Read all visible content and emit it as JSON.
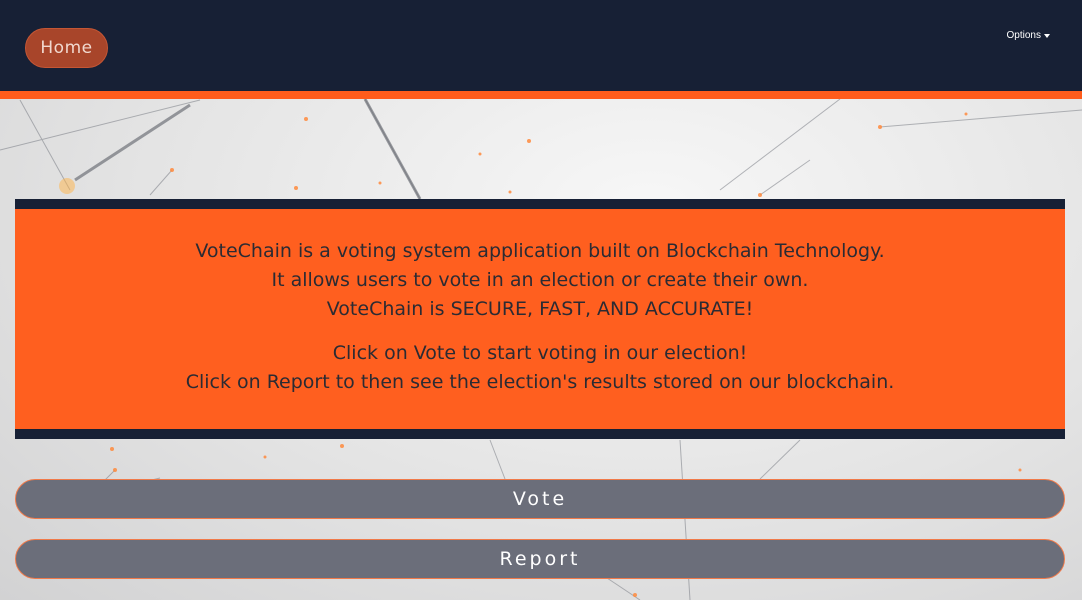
{
  "navbar": {
    "home_label": "Home",
    "options_label": "Options"
  },
  "info": {
    "lines_1": [
      "VoteChain is a voting system application built on Blockchain Technology.",
      "It allows users to vote in an election or create their own.",
      "VoteChain is SECURE, FAST, AND ACCURATE!"
    ],
    "lines_2": [
      "Click on Vote to start voting in our election!",
      "Click on Report to then see the election's results stored on our blockchain."
    ]
  },
  "actions": {
    "vote_label": "Vote",
    "report_label": "Report"
  },
  "colors": {
    "navbar": "#172035",
    "accent": "#ff5c1c",
    "panel": "#ff5f1f",
    "button": "#6b6e7a",
    "home_button": "#a8452a"
  }
}
